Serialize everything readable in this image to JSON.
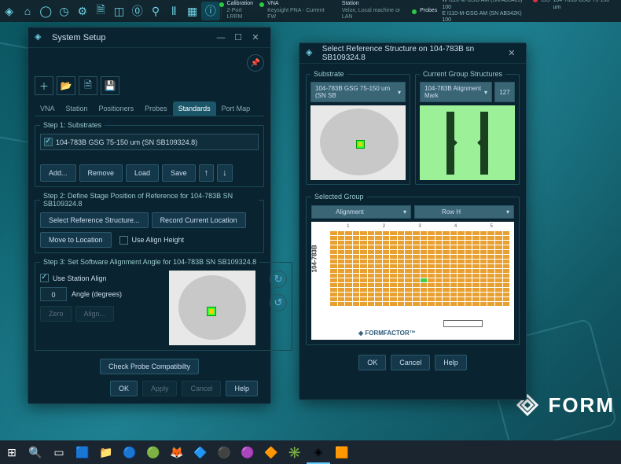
{
  "topbar": {
    "status": [
      {
        "label": "Calibration",
        "value": "2-Port LRRM",
        "dot": true
      },
      {
        "label": "VNA",
        "value": "Keysight PNA - Current FW",
        "dot": true
      },
      {
        "label": "Station",
        "value": "Velox, Local machine or LAN",
        "dot": false
      },
      {
        "label": "Probes",
        "value": "",
        "dot": true
      }
    ],
    "right": [
      {
        "a": "W I110-M-GSG AM (SN AB342J) 100",
        "b": "E I110-M-GSG AM (SN AB342K) 100"
      },
      {
        "a": "ISS",
        "b": ""
      },
      {
        "a": "104-783B GSG 75-150 um",
        "b": ""
      }
    ]
  },
  "setup": {
    "title": "System Setup",
    "tabs": [
      "VNA",
      "Station",
      "Positioners",
      "Probes",
      "Standards",
      "Port Map"
    ],
    "step1": {
      "legend": "Step 1: Substrates",
      "item": "104-783B GSG 75-150 um (SN SB109324.8)",
      "add": "Add...",
      "remove": "Remove",
      "load": "Load",
      "save": "Save"
    },
    "step2": {
      "legend": "Step 2: Define Stage Position of Reference for 104-783B SN SB109324.8",
      "select": "Select Reference Structure...",
      "record": "Record Current Location",
      "move": "Move to Location",
      "align": "Use Align Height"
    },
    "step3": {
      "legend": "Step 3: Set Software Alignment Angle for 104-783B SN SB109324.8",
      "use": "Use Station Align",
      "angle": "0",
      "anglelbl": "Angle (degrees)",
      "zero": "Zero",
      "alignbtn": "Align..."
    },
    "check": "Check Probe Compatibilty",
    "footer": {
      "ok": "OK",
      "apply": "Apply",
      "cancel": "Cancel",
      "help": "Help"
    }
  },
  "ref": {
    "title": "Select Reference Structure on 104-783B sn SB109324.8",
    "substrate": {
      "legend": "Substrate",
      "dd": "104-783B GSG 75-150 um (SN SB"
    },
    "current": {
      "legend": "Current Group Structures",
      "dd": "104-783B Alignment Mark",
      "count": "127"
    },
    "selected": {
      "legend": "Selected Group",
      "dd1": "Alignment",
      "dd2": "Row H",
      "label": "104-783B",
      "ff": "◈ FORMFACTOR™"
    },
    "footer": {
      "ok": "OK",
      "cancel": "Cancel",
      "help": "Help"
    }
  },
  "logo": "FORM"
}
